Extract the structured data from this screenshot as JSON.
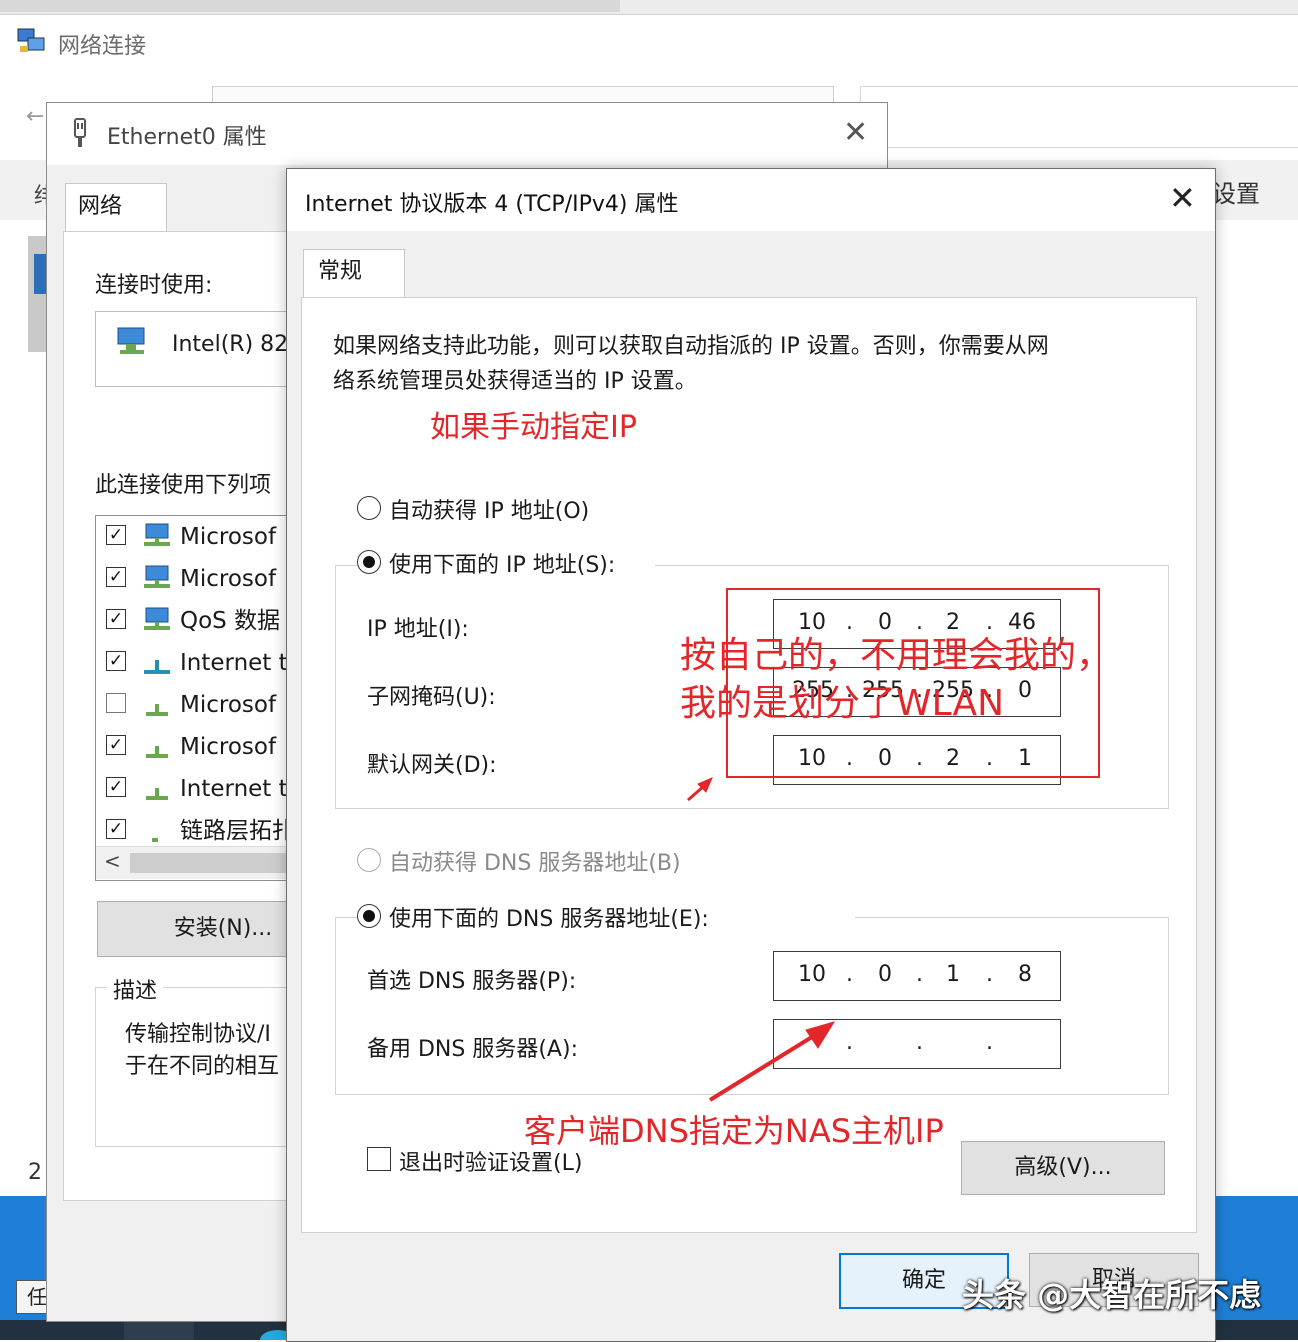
{
  "background_window": {
    "title": "网络连接",
    "cmd_fragment_left": "绯",
    "cmd_fragment_right": "设置",
    "status_fragment": "2"
  },
  "taskbar": {
    "task_view_label": "任务视图"
  },
  "ethernet_dialog": {
    "title": "Ethernet0 属性",
    "tab_network": "网络",
    "connect_using_label": "连接时使用:",
    "adapter_name": "Intel(R) 82",
    "items_label": "此连接使用下列项",
    "items": [
      {
        "label": "Microsof",
        "checked": true,
        "icon": "network-client-icon"
      },
      {
        "label": "Microsof",
        "checked": true,
        "icon": "network-client-icon"
      },
      {
        "label": "QoS 数据",
        "checked": true,
        "icon": "network-client-icon"
      },
      {
        "label": "Internet t",
        "checked": true,
        "icon": "protocol-icon"
      },
      {
        "label": "Microsof",
        "checked": false,
        "icon": "protocol-icon"
      },
      {
        "label": "Microsof",
        "checked": true,
        "icon": "protocol-icon"
      },
      {
        "label": "Internet t",
        "checked": true,
        "icon": "protocol-icon"
      },
      {
        "label": "链路层拓扑",
        "checked": true,
        "icon": "protocol-icon"
      }
    ],
    "install_button": "安装(N)...",
    "description_legend": "描述",
    "description_text": "传输控制协议/I\n于在不同的相互"
  },
  "ipv4_dialog": {
    "title": "Internet 协议版本 4 (TCP/IPv4) 属性",
    "tab_general": "常规",
    "intro_line1": "如果网络支持此功能，则可以获取自动指派的 IP 设置。否则，你需要从网",
    "intro_line2": "络系统管理员处获得适当的 IP 设置。",
    "radio_auto_ip": "自动获得 IP 地址(O)",
    "radio_manual_ip": "使用下面的 IP 地址(S):",
    "ip_label": "IP 地址(I):",
    "ip_value": [
      "10",
      "0",
      "2",
      "46"
    ],
    "subnet_label": "子网掩码(U):",
    "subnet_value": [
      "255",
      "255",
      "255",
      "0"
    ],
    "gateway_label": "默认网关(D):",
    "gateway_value": [
      "10",
      "0",
      "2",
      "1"
    ],
    "radio_auto_dns": "自动获得 DNS 服务器地址(B)",
    "radio_manual_dns": "使用下面的 DNS 服务器地址(E):",
    "preferred_dns_label": "首选 DNS 服务器(P):",
    "preferred_dns_value": [
      "10",
      "0",
      "1",
      "8"
    ],
    "alternate_dns_label": "备用 DNS 服务器(A):",
    "alternate_dns_value": [
      "",
      "",
      "",
      ""
    ],
    "validate_on_exit": "退出时验证设置(L)",
    "advanced_button": "高级(V)...",
    "ok_button": "确定",
    "cancel_button": "取消"
  },
  "annotations": {
    "manual_ip_note": "如果手动指定IP",
    "own_settings_line1": "按自己的，不用理会我的，",
    "own_settings_line2": "我的是划分了WLAN",
    "dns_note": "客户端DNS指定为NAS主机IP",
    "color": "#e3262a"
  },
  "watermark": "头条 @大智在所不虑"
}
